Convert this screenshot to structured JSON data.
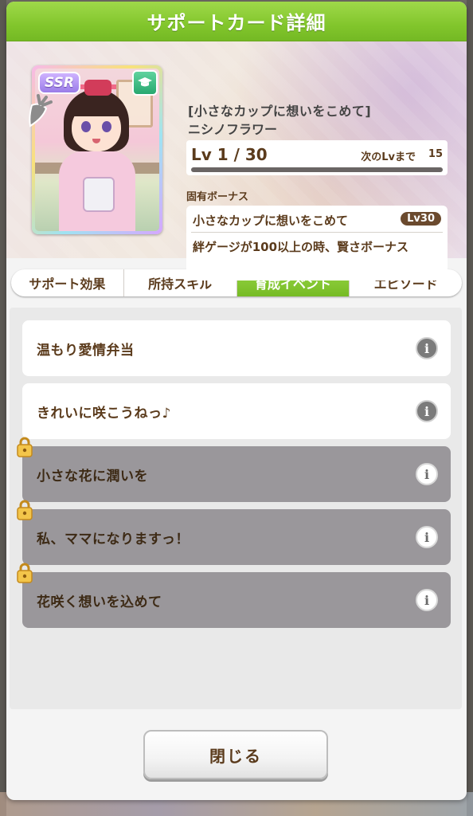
{
  "dialog": {
    "title": "サポートカード詳細"
  },
  "card": {
    "rarity": "SSR",
    "type_icon": "graduation-cap-icon",
    "title": "[小さなカップに想いをこめて]",
    "character": "ニシノフラワー",
    "level_text": "Lv 1 / 30",
    "level_progress": 0.0,
    "next_level_label": "次のLvまで",
    "next_level_value": "15"
  },
  "bonus": {
    "heading": "固有ボーナス",
    "name": "小さなカップに想いをこめて",
    "level": "Lv30",
    "description": "絆ゲージが100以上の時、賢さボーナス"
  },
  "tabs": [
    {
      "label": "サポート効果",
      "active": false
    },
    {
      "label": "所持スキル",
      "active": false
    },
    {
      "label": "育成イベント",
      "active": true
    },
    {
      "label": "エピソード",
      "active": false
    }
  ],
  "events": [
    {
      "label": "温もり愛情弁当",
      "locked": false
    },
    {
      "label": "きれいに咲こうねっ♪",
      "locked": false
    },
    {
      "label": "小さな花に潤いを",
      "locked": true
    },
    {
      "label": "私、ママになりますっ！",
      "locked": true
    },
    {
      "label": "花咲く想いを込めて",
      "locked": true
    }
  ],
  "footer": {
    "close_label": "閉じる"
  },
  "colors": {
    "accent_green": "#82c62c",
    "text_brown": "#5b3b1c",
    "locked_gray": "#9a979b"
  }
}
